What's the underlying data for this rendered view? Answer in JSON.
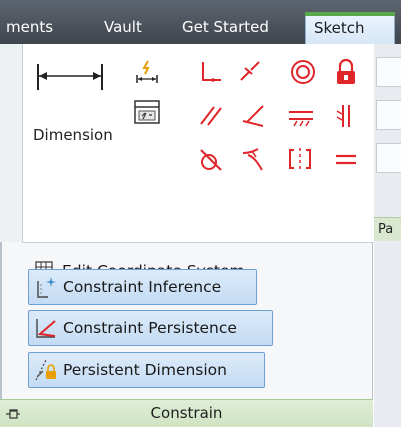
{
  "tabs": [
    {
      "label": "ments",
      "active": false
    },
    {
      "label": "Vault",
      "active": false
    },
    {
      "label": "Get Started",
      "active": false
    },
    {
      "label": "Sketch",
      "active": true
    }
  ],
  "dimension": {
    "label": "Dimension"
  },
  "side_panel_label": "Pa",
  "constraint_icons": [
    "auto-dimension-icon",
    "show-constraints-icon",
    "coincident-icon",
    "collinear-icon",
    "concentric-icon",
    "fix-icon",
    "parallel-icon",
    "perpendicular-icon",
    "horizontal-icon",
    "vertical-icon",
    "tangent-icon",
    "smooth-icon",
    "symmetric-icon",
    "equal-icon"
  ],
  "menu": {
    "items": [
      {
        "label": "Edit Coordinate System",
        "icon": "coordinate-system-icon",
        "highlighted": false
      },
      {
        "label": "Constraint Inference",
        "icon": "constraint-inference-icon",
        "highlighted": true
      },
      {
        "label": "Constraint Persistence",
        "icon": "constraint-persistence-icon",
        "highlighted": true
      },
      {
        "label": "Persistent Dimension",
        "icon": "persistent-dimension-icon",
        "highlighted": true
      }
    ]
  },
  "footer": {
    "label": "Constrain",
    "icon": "pin-icon"
  },
  "colors": {
    "accent_green": "#58a84c",
    "constraint_red": "#e0262a",
    "highlight_blue": "#c4dbf3"
  }
}
